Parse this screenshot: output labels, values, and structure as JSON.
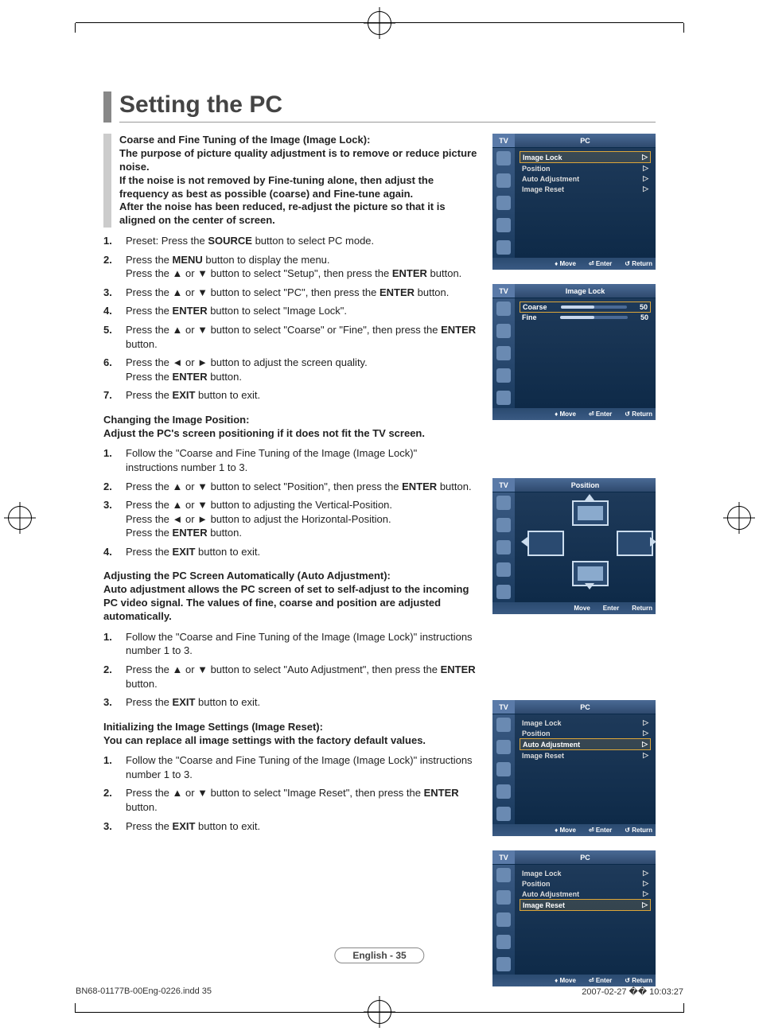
{
  "title": "Setting the PC",
  "section1": {
    "intro": "Coarse and Fine Tuning of the Image (Image Lock):\nThe purpose of picture quality adjustment is to remove or reduce picture noise.\nIf the noise is not removed by Fine-tuning alone, then adjust the frequency as best as possible (coarse) and Fine-tune again.\nAfter the noise has been reduced, re-adjust the picture so that it is aligned on the center of screen.",
    "steps": [
      "Preset: Press the <b>SOURCE</b> button to select PC mode.",
      "Press the <b>MENU</b> button to display the menu.<br>Press the ▲ or ▼ button to select \"Setup\", then press the <b>ENTER</b> button.",
      "Press the ▲ or ▼ button to select \"PC\", then press the <b>ENTER</b> button.",
      "Press the <b>ENTER</b> button to select \"Image Lock\".",
      "Press the  ▲ or ▼ button to select \"Coarse\" or \"Fine\", then press the <b>ENTER</b> button.",
      "Press the ◄ or ► button to adjust the screen quality.<br>Press the <b>ENTER</b> button.",
      "Press the <b>EXIT</b> button to exit."
    ]
  },
  "section2": {
    "intro": "Changing the Image Position:\nAdjust the PC's screen positioning if it does not fit the TV screen.",
    "steps": [
      "Follow the \"Coarse and Fine Tuning of the Image (Image Lock)\"<br>instructions number 1 to 3.",
      "Press the ▲ or ▼ button to select \"Position\", then press the <b>ENTER</b> button.",
      "Press the ▲ or ▼ button to adjusting the Vertical-Position.<br>Press the ◄ or ► button to adjust the Horizontal-Position.<br>Press the <b>ENTER</b> button.",
      "Press the <b>EXIT</b> button to exit."
    ]
  },
  "section3": {
    "intro": "Adjusting the PC Screen Automatically (Auto Adjustment):\nAuto adjustment allows the PC screen of set to self-adjust to the incoming PC video signal. The values of fine, coarse and position are adjusted automatically.",
    "steps": [
      "Follow the \"Coarse and Fine Tuning of the Image (Image Lock)\" instructions number 1 to 3.",
      "Press the ▲ or ▼ button to select \"Auto Adjustment\", then press the <b>ENTER</b> button.",
      "Press the <b>EXIT</b> button to exit."
    ]
  },
  "section4": {
    "intro": "Initializing the Image Settings (Image Reset):\nYou can replace all image settings with the factory default values.",
    "steps": [
      "Follow the \"Coarse and Fine Tuning of the Image (Image Lock)\" instructions number 1 to 3.",
      "Press the ▲ or ▼ button to select \"Image Reset\", then press the <b>ENTER</b> button.",
      "Press the <b>EXIT</b> button to exit."
    ]
  },
  "osd_corner": "TV",
  "osd_foot": {
    "move": "Move",
    "enter": "Enter",
    "return": "Return"
  },
  "osd1": {
    "title": "PC",
    "items": [
      "Image Lock",
      "Position",
      "Auto Adjustment",
      "Image Reset"
    ],
    "sel": 0
  },
  "osd2": {
    "title": "Image Lock",
    "sliders": [
      {
        "label": "Coarse",
        "value": "50"
      },
      {
        "label": "Fine",
        "value": "50"
      }
    ],
    "sel": 0
  },
  "osd3": {
    "title": "Position"
  },
  "osd4": {
    "title": "PC",
    "items": [
      "Image Lock",
      "Position",
      "Auto Adjustment",
      "Image Reset"
    ],
    "sel": 2
  },
  "osd5": {
    "title": "PC",
    "items": [
      "Image Lock",
      "Position",
      "Auto Adjustment",
      "Image Reset"
    ],
    "sel": 3
  },
  "pagenum": "English - 35",
  "footer_left": "BN68-01177B-00Eng-0226.indd   35",
  "footer_right": "2007-02-27   �� 10:03:27"
}
